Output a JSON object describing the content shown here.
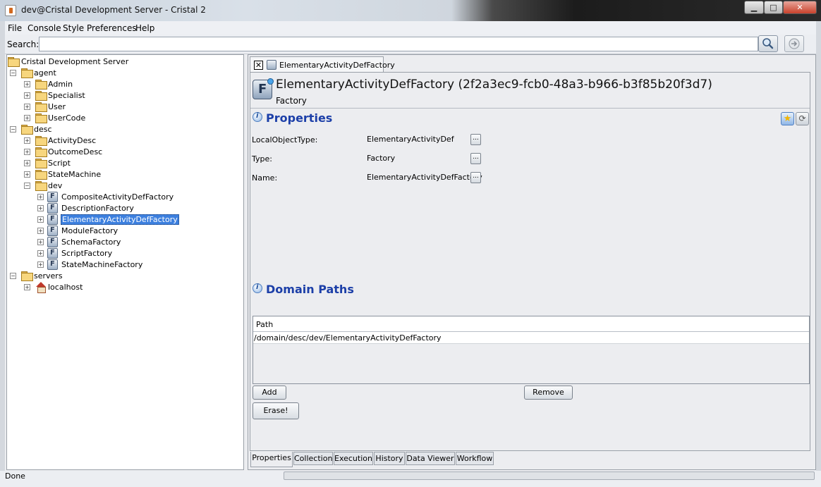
{
  "window": {
    "title": "dev@Cristal Development Server - Cristal 2",
    "minimize": "▁",
    "maximize": "□",
    "close": "✕"
  },
  "menu": [
    "File",
    "Console",
    "Style",
    "Preferences",
    "Help"
  ],
  "search": {
    "label": "Search:",
    "value": "",
    "search_icon": "magnifier-icon",
    "go_icon": "arrow-right-icon"
  },
  "tree": {
    "root": "Cristal Development Server",
    "nodes": [
      {
        "label": "agent",
        "expanded": true,
        "icon": "folder-icon"
      },
      {
        "label": "Admin",
        "expanded": false,
        "icon": "folder-icon"
      },
      {
        "label": "Specialist",
        "expanded": false,
        "icon": "folder-icon"
      },
      {
        "label": "User",
        "expanded": false,
        "icon": "folder-icon"
      },
      {
        "label": "UserCode",
        "expanded": false,
        "icon": "folder-icon"
      },
      {
        "label": "desc",
        "expanded": true,
        "icon": "folder-icon"
      },
      {
        "label": "ActivityDesc",
        "expanded": false,
        "icon": "folder-icon"
      },
      {
        "label": "OutcomeDesc",
        "expanded": false,
        "icon": "folder-icon"
      },
      {
        "label": "Script",
        "expanded": false,
        "icon": "folder-icon"
      },
      {
        "label": "StateMachine",
        "expanded": false,
        "icon": "folder-icon"
      },
      {
        "label": "dev",
        "expanded": true,
        "icon": "folder-icon"
      },
      {
        "label": "CompositeActivityDefFactory",
        "icon": "factory-icon"
      },
      {
        "label": "DescriptionFactory",
        "icon": "factory-icon"
      },
      {
        "label": "ElementaryActivityDefFactory",
        "icon": "factory-icon",
        "selected": true
      },
      {
        "label": "ModuleFactory",
        "icon": "factory-icon"
      },
      {
        "label": "SchemaFactory",
        "icon": "factory-icon"
      },
      {
        "label": "ScriptFactory",
        "icon": "factory-icon"
      },
      {
        "label": "StateMachineFactory",
        "icon": "factory-icon"
      },
      {
        "label": "servers",
        "expanded": true,
        "icon": "folder-icon"
      },
      {
        "label": "localhost",
        "expanded": false,
        "icon": "house-icon"
      }
    ]
  },
  "tab": {
    "label": "ElementaryActivityDefFactory",
    "close_glyph": "✕"
  },
  "item": {
    "title": "ElementaryActivityDefFactory (2f2a3ec9-fcb0-48a3-b966-b3f85b20f3d7)",
    "subtitle": "Factory"
  },
  "properties": {
    "heading": "Properties",
    "star_glyph": "★",
    "reload_glyph": "⟳",
    "rows": [
      {
        "name": "LocalObjectType:",
        "value": "ElementaryActivityDef",
        "button": "..."
      },
      {
        "name": "Type:",
        "value": "Factory",
        "button": "..."
      },
      {
        "name": "Name:",
        "value": "ElementaryActivityDefFactory",
        "button": "..."
      }
    ]
  },
  "domain_paths": {
    "heading": "Domain Paths",
    "column": "Path",
    "rows": [
      "/domain/desc/dev/ElementaryActivityDefFactory"
    ],
    "add_label": "Add",
    "remove_label": "Remove",
    "erase_label": "Erase!"
  },
  "bottom_tabs": [
    "Properties",
    "Collection",
    "Execution",
    "History",
    "Data Viewer",
    "Workflow"
  ],
  "status": {
    "text": "Done"
  },
  "colors": {
    "accent": "#1c3fa8",
    "selection": "#3d80df"
  }
}
